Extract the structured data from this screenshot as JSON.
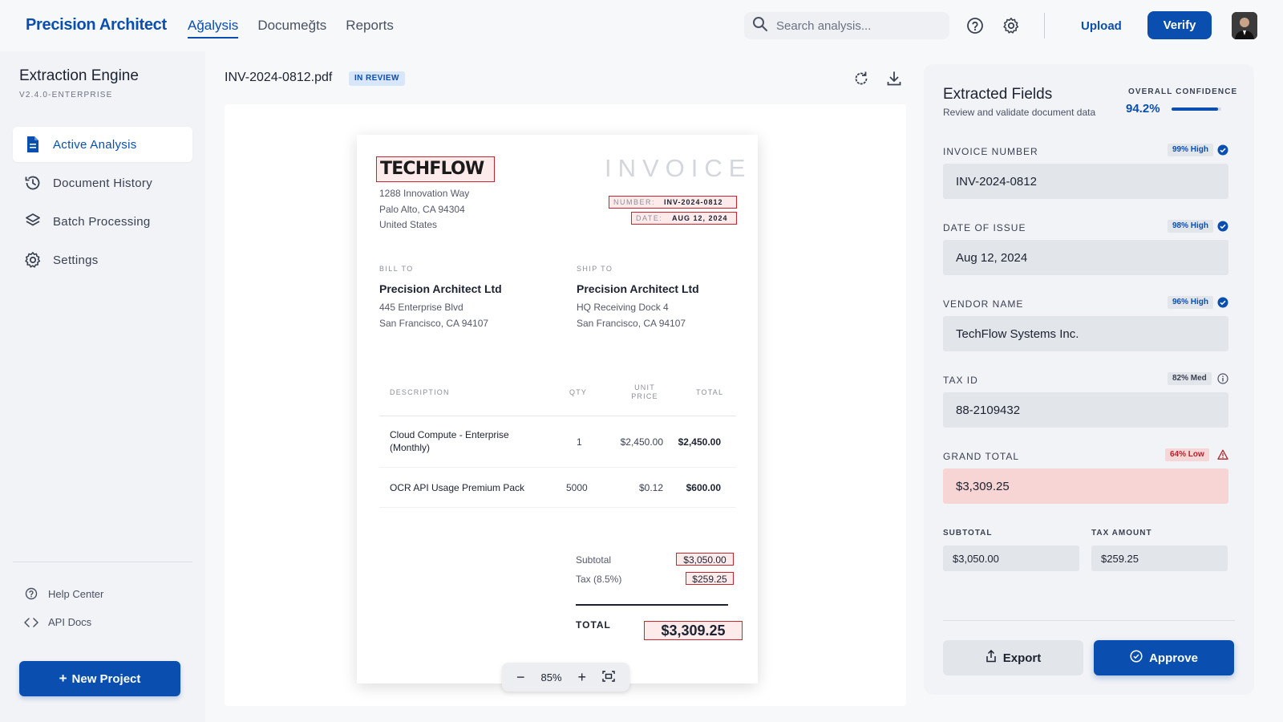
{
  "header": {
    "brand": "Precision Architect",
    "tabs": [
      {
        "label": "Ağalysis",
        "active": true
      },
      {
        "label": "Documeğts",
        "active": false
      },
      {
        "label": "Reports",
        "active": false
      }
    ],
    "search_placeholder": "Search analysis...",
    "upload_label": "Upload",
    "verify_label": "Verify",
    "icons": [
      "search-icon",
      "help-icon",
      "gear-icon",
      "avatar"
    ]
  },
  "sidebar": {
    "title": "Extraction Engine",
    "version": "V2.4.0-ENTERPRISE",
    "items": [
      {
        "label": "Active Analysis",
        "icon": "document-icon",
        "active": true
      },
      {
        "label": "Document History",
        "icon": "history-icon",
        "active": false
      },
      {
        "label": "Batch Processing",
        "icon": "layers-icon",
        "active": false
      },
      {
        "label": "Settings",
        "icon": "gear-icon",
        "active": false
      }
    ],
    "links": [
      {
        "label": "Help Center",
        "icon": "help-icon"
      },
      {
        "label": "API Docs",
        "icon": "code-icon"
      }
    ],
    "new_project_label": "New Project"
  },
  "viewer": {
    "filename": "INV-2024-0812.pdf",
    "status": "IN REVIEW",
    "zoom": "85%",
    "invoice": {
      "logo": "TECHFLOW",
      "heading": "INVOICE",
      "vendor_address": [
        "1288 Innovation Way",
        "Palo Alto, CA 94304",
        "United States"
      ],
      "number_label": "NUMBER:",
      "number": "INV-2024-0812",
      "date_label": "DATE:",
      "date": "AUG 12, 2024",
      "bill_to_label": "BILL TO",
      "bill_to_name": "Precision Architect Ltd",
      "bill_to_lines": [
        "445 Enterprise Blvd",
        "San Francisco, CA 94107"
      ],
      "ship_to_label": "SHIP TO",
      "ship_to_name": "Precision Architect Ltd",
      "ship_to_lines": [
        "HQ Receiving Dock 4",
        "San Francisco, CA 94107"
      ],
      "columns": [
        "DESCRIPTION",
        "QTY",
        "UNIT PRICE",
        "TOTAL"
      ],
      "rows": [
        {
          "desc": "Cloud Compute - Enterprise (Monthly)",
          "qty": "1",
          "unit": "$2,450.00",
          "total": "$2,450.00"
        },
        {
          "desc": "OCR API Usage Premium Pack",
          "qty": "5000",
          "unit": "$0.12",
          "total": "$600.00"
        }
      ],
      "subtotal_label": "Subtotal",
      "subtotal": "$3,050.00",
      "tax_label": "Tax (8.5%)",
      "tax": "$259.25",
      "total_label": "TOTAL",
      "total": "$3,309.25"
    }
  },
  "panel": {
    "title": "Extracted Fields",
    "subtitle": "Review and validate document data",
    "confidence_label": "OVERALL CONFIDENCE",
    "confidence_value": "94.2%",
    "confidence_fraction": 0.942,
    "fields": [
      {
        "label": "INVOICE NUMBER",
        "badge": "99% High",
        "level": "high",
        "value": "INV-2024-0812"
      },
      {
        "label": "DATE OF ISSUE",
        "badge": "98% High",
        "level": "high",
        "value": "Aug 12, 2024"
      },
      {
        "label": "VENDOR NAME",
        "badge": "96% High",
        "level": "high",
        "value": "TechFlow Systems Inc."
      },
      {
        "label": "TAX ID",
        "badge": "82% Med",
        "level": "med",
        "value": "88-2109432"
      },
      {
        "label": "GRAND TOTAL",
        "badge": "64% Low",
        "level": "low",
        "value": "$3,309.25"
      }
    ],
    "subtotal_label": "SUBTOTAL",
    "subtotal_value": "$3,050.00",
    "tax_amount_label": "TAX AMOUNT",
    "tax_amount_value": "$259.25",
    "export_label": "Export",
    "approve_label": "Approve"
  },
  "colors": {
    "primary": "#0a4fb0",
    "highlight": "#c8262e",
    "low_confidence_bg": "#f8d5d5"
  }
}
